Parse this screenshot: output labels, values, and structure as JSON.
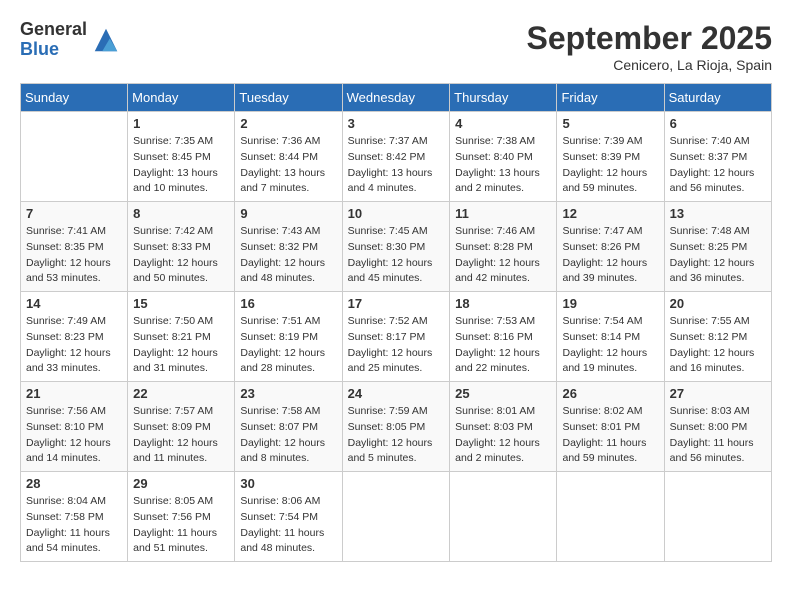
{
  "logo": {
    "general": "General",
    "blue": "Blue"
  },
  "header": {
    "month": "September 2025",
    "location": "Cenicero, La Rioja, Spain"
  },
  "weekdays": [
    "Sunday",
    "Monday",
    "Tuesday",
    "Wednesday",
    "Thursday",
    "Friday",
    "Saturday"
  ],
  "weeks": [
    [
      {
        "day": null
      },
      {
        "day": "1",
        "sunrise": "7:35 AM",
        "sunset": "8:45 PM",
        "daylight": "13 hours and 10 minutes."
      },
      {
        "day": "2",
        "sunrise": "7:36 AM",
        "sunset": "8:44 PM",
        "daylight": "13 hours and 7 minutes."
      },
      {
        "day": "3",
        "sunrise": "7:37 AM",
        "sunset": "8:42 PM",
        "daylight": "13 hours and 4 minutes."
      },
      {
        "day": "4",
        "sunrise": "7:38 AM",
        "sunset": "8:40 PM",
        "daylight": "13 hours and 2 minutes."
      },
      {
        "day": "5",
        "sunrise": "7:39 AM",
        "sunset": "8:39 PM",
        "daylight": "12 hours and 59 minutes."
      },
      {
        "day": "6",
        "sunrise": "7:40 AM",
        "sunset": "8:37 PM",
        "daylight": "12 hours and 56 minutes."
      }
    ],
    [
      {
        "day": "7",
        "sunrise": "7:41 AM",
        "sunset": "8:35 PM",
        "daylight": "12 hours and 53 minutes."
      },
      {
        "day": "8",
        "sunrise": "7:42 AM",
        "sunset": "8:33 PM",
        "daylight": "12 hours and 50 minutes."
      },
      {
        "day": "9",
        "sunrise": "7:43 AM",
        "sunset": "8:32 PM",
        "daylight": "12 hours and 48 minutes."
      },
      {
        "day": "10",
        "sunrise": "7:45 AM",
        "sunset": "8:30 PM",
        "daylight": "12 hours and 45 minutes."
      },
      {
        "day": "11",
        "sunrise": "7:46 AM",
        "sunset": "8:28 PM",
        "daylight": "12 hours and 42 minutes."
      },
      {
        "day": "12",
        "sunrise": "7:47 AM",
        "sunset": "8:26 PM",
        "daylight": "12 hours and 39 minutes."
      },
      {
        "day": "13",
        "sunrise": "7:48 AM",
        "sunset": "8:25 PM",
        "daylight": "12 hours and 36 minutes."
      }
    ],
    [
      {
        "day": "14",
        "sunrise": "7:49 AM",
        "sunset": "8:23 PM",
        "daylight": "12 hours and 33 minutes."
      },
      {
        "day": "15",
        "sunrise": "7:50 AM",
        "sunset": "8:21 PM",
        "daylight": "12 hours and 31 minutes."
      },
      {
        "day": "16",
        "sunrise": "7:51 AM",
        "sunset": "8:19 PM",
        "daylight": "12 hours and 28 minutes."
      },
      {
        "day": "17",
        "sunrise": "7:52 AM",
        "sunset": "8:17 PM",
        "daylight": "12 hours and 25 minutes."
      },
      {
        "day": "18",
        "sunrise": "7:53 AM",
        "sunset": "8:16 PM",
        "daylight": "12 hours and 22 minutes."
      },
      {
        "day": "19",
        "sunrise": "7:54 AM",
        "sunset": "8:14 PM",
        "daylight": "12 hours and 19 minutes."
      },
      {
        "day": "20",
        "sunrise": "7:55 AM",
        "sunset": "8:12 PM",
        "daylight": "12 hours and 16 minutes."
      }
    ],
    [
      {
        "day": "21",
        "sunrise": "7:56 AM",
        "sunset": "8:10 PM",
        "daylight": "12 hours and 14 minutes."
      },
      {
        "day": "22",
        "sunrise": "7:57 AM",
        "sunset": "8:09 PM",
        "daylight": "12 hours and 11 minutes."
      },
      {
        "day": "23",
        "sunrise": "7:58 AM",
        "sunset": "8:07 PM",
        "daylight": "12 hours and 8 minutes."
      },
      {
        "day": "24",
        "sunrise": "7:59 AM",
        "sunset": "8:05 PM",
        "daylight": "12 hours and 5 minutes."
      },
      {
        "day": "25",
        "sunrise": "8:01 AM",
        "sunset": "8:03 PM",
        "daylight": "12 hours and 2 minutes."
      },
      {
        "day": "26",
        "sunrise": "8:02 AM",
        "sunset": "8:01 PM",
        "daylight": "11 hours and 59 minutes."
      },
      {
        "day": "27",
        "sunrise": "8:03 AM",
        "sunset": "8:00 PM",
        "daylight": "11 hours and 56 minutes."
      }
    ],
    [
      {
        "day": "28",
        "sunrise": "8:04 AM",
        "sunset": "7:58 PM",
        "daylight": "11 hours and 54 minutes."
      },
      {
        "day": "29",
        "sunrise": "8:05 AM",
        "sunset": "7:56 PM",
        "daylight": "11 hours and 51 minutes."
      },
      {
        "day": "30",
        "sunrise": "8:06 AM",
        "sunset": "7:54 PM",
        "daylight": "11 hours and 48 minutes."
      },
      {
        "day": null
      },
      {
        "day": null
      },
      {
        "day": null
      },
      {
        "day": null
      }
    ]
  ],
  "labels": {
    "sunrise": "Sunrise:",
    "sunset": "Sunset:",
    "daylight": "Daylight:"
  }
}
